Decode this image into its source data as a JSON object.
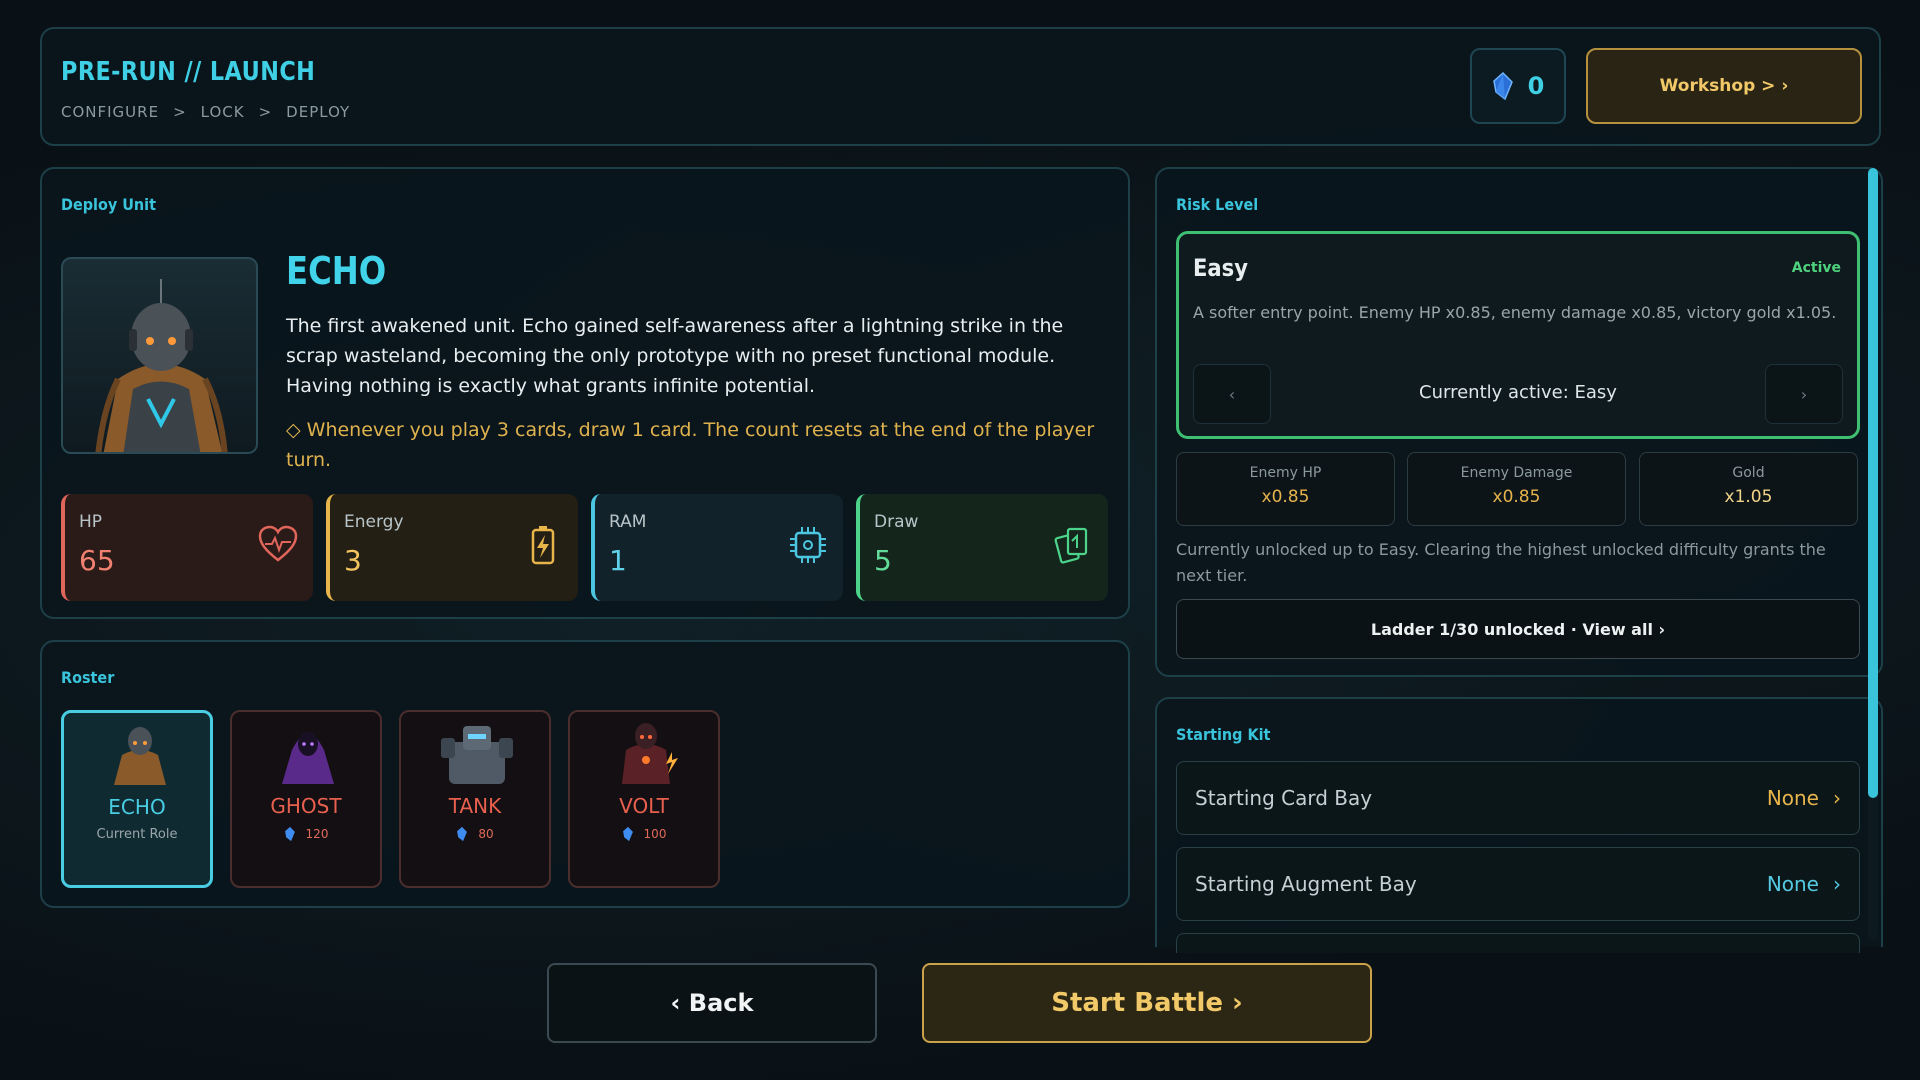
{
  "header": {
    "title": "PRE-RUN // LAUNCH",
    "breadcrumb": [
      "CONFIGURE",
      ">",
      "LOCK",
      ">",
      "DEPLOY"
    ],
    "gem_count": "0",
    "workshop_label": "Workshop > ›"
  },
  "deploy": {
    "label": "Deploy Unit",
    "unit_name": "ECHO",
    "description": "The first awakened unit. Echo gained self-awareness after a lightning strike in the scrap wasteland, becoming the only prototype with no preset functional module. Having nothing is exactly what grants infinite potential.",
    "passive": "◇  Whenever you play 3 cards, draw 1 card. The count resets at the end of the player turn.",
    "stats": {
      "hp": {
        "name": "HP",
        "value": "65",
        "icon": "heart-pulse-icon"
      },
      "energy": {
        "name": "Energy",
        "value": "3",
        "icon": "battery-bolt-icon"
      },
      "ram": {
        "name": "RAM",
        "value": "1",
        "icon": "chip-icon"
      },
      "draw": {
        "name": "Draw",
        "value": "5",
        "icon": "cards-icon"
      }
    }
  },
  "roster": {
    "label": "Roster",
    "heroes": [
      {
        "name": "ECHO",
        "sub": "Current Role",
        "selected": true
      },
      {
        "name": "GHOST",
        "cost": "120"
      },
      {
        "name": "TANK",
        "cost": "80"
      },
      {
        "name": "VOLT",
        "cost": "100"
      }
    ]
  },
  "risk": {
    "label": "Risk Level",
    "name": "Easy",
    "status": "Active",
    "description": "A softer entry point. Enemy HP x0.85, enemy damage x0.85, victory gold x1.05.",
    "prev": "‹",
    "next": "›",
    "current": "Currently active: Easy",
    "multipliers": {
      "enemy_hp": {
        "name": "Enemy HP",
        "value": "x0.85"
      },
      "enemy_damage": {
        "name": "Enemy Damage",
        "value": "x0.85"
      },
      "gold": {
        "name": "Gold",
        "value": "x1.05"
      }
    },
    "note": "Currently unlocked up to Easy. Clearing the highest unlocked difficulty grants the next tier.",
    "ladder": "Ladder 1/30 unlocked · View all ›"
  },
  "kit": {
    "label": "Starting Kit",
    "card_bay": {
      "name": "Starting Card Bay",
      "value": "None",
      "chevron": "›"
    },
    "augment_bay": {
      "name": "Starting Augment Bay",
      "value": "None",
      "chevron": "›"
    }
  },
  "footer": {
    "back": "‹  Back",
    "start": "Start Battle  ›"
  },
  "colors": {
    "accent": "#39c4dc",
    "gold": "#e8b54a",
    "hp": "#e0655a",
    "draw": "#4cd48a",
    "active": "#3fbf72"
  }
}
